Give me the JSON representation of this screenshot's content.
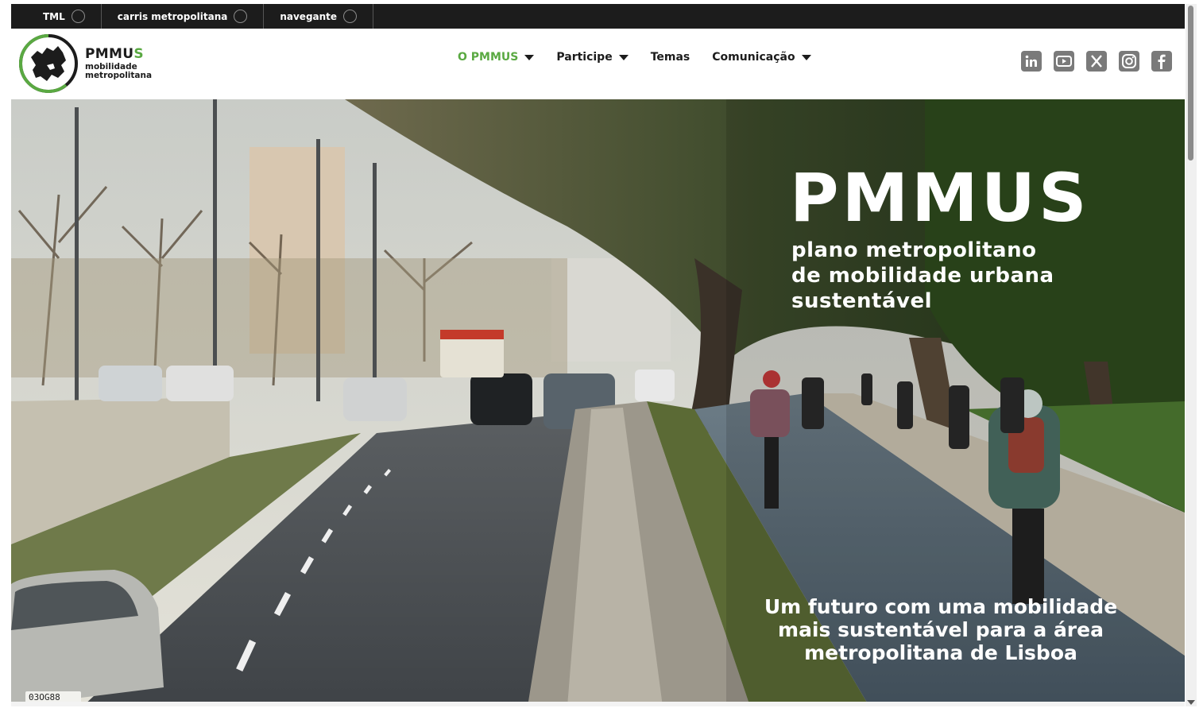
{
  "topbar": {
    "partners": [
      {
        "label": "TML"
      },
      {
        "label": "carris metropolitana"
      },
      {
        "label": "navegante"
      }
    ]
  },
  "header": {
    "logo": {
      "title_main": "PMMU",
      "title_accent": "S",
      "line1": "mobilidade",
      "line2": "metropolitana"
    },
    "nav": [
      {
        "label": "O PMMUS",
        "active": true,
        "dropdown": true
      },
      {
        "label": "Participe",
        "active": false,
        "dropdown": true
      },
      {
        "label": "Temas",
        "active": false,
        "dropdown": false
      },
      {
        "label": "Comunicação",
        "active": false,
        "dropdown": true
      }
    ],
    "social": [
      "linkedin-icon",
      "youtube-icon",
      "x-icon",
      "instagram-icon",
      "facebook-icon"
    ]
  },
  "hero": {
    "title": "PMMUS",
    "subtitle_lines": [
      "plano metropolitano",
      "de mobilidade urbana",
      "sustentável"
    ],
    "tagline_lines": [
      "Um futuro com uma mobilidade",
      "mais sustentável para a área",
      "metropolitana de Lisboa"
    ],
    "car_plate": "03OG88"
  },
  "colors": {
    "accent": "#5aa942",
    "topbar": "#1c1c1c",
    "text": "#1c1c1c",
    "icon_gray": "#7a7a7a"
  }
}
